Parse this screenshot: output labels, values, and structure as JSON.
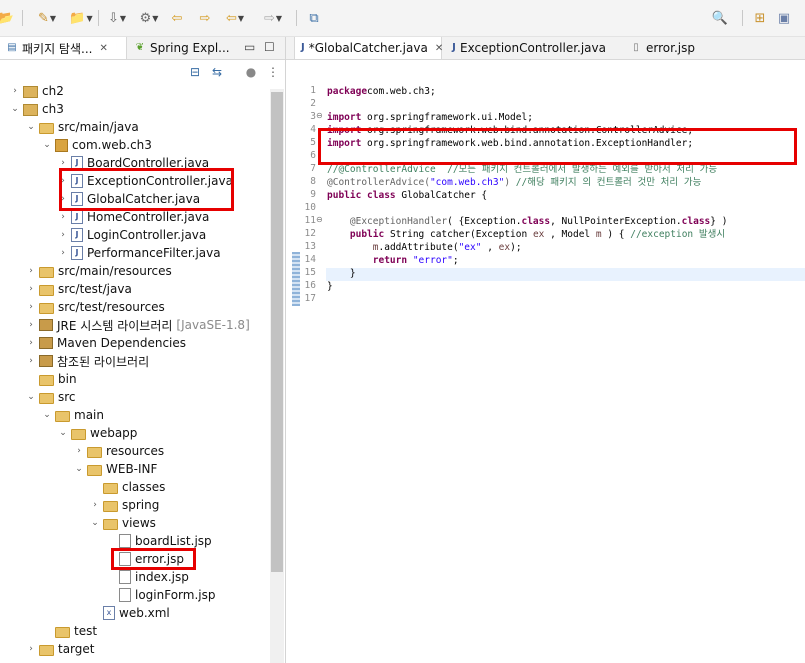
{
  "toolbar": {
    "icons": [
      "new-folder-icon",
      "run-icon",
      "open-icon",
      "download-icon",
      "tools-icon",
      "back-icon",
      "forward-icon",
      "nav-back-icon",
      "nav-forward-icon",
      "new-window-icon",
      "search-icon",
      "perspective-icon",
      "java-perspective-icon"
    ]
  },
  "left_panel": {
    "tabs": [
      {
        "label": "패키지 탐색...",
        "active": true
      },
      {
        "label": "Spring Expl...",
        "active": false
      }
    ],
    "tree": [
      {
        "label": "ch2",
        "icon": "project",
        "indent": 0,
        "twisty": ">"
      },
      {
        "label": "ch3",
        "icon": "project",
        "indent": 0,
        "twisty": "v"
      },
      {
        "label": "src/main/java",
        "icon": "srcfolder",
        "indent": 1,
        "twisty": "v"
      },
      {
        "label": "com.web.ch3",
        "icon": "package",
        "indent": 2,
        "twisty": "v"
      },
      {
        "label": "BoardController.java",
        "icon": "java",
        "indent": 3,
        "twisty": ">"
      },
      {
        "label": "ExceptionController.java",
        "icon": "java",
        "indent": 3,
        "twisty": ">"
      },
      {
        "label": "GlobalCatcher.java",
        "icon": "java",
        "indent": 3,
        "twisty": ">"
      },
      {
        "label": "HomeController.java",
        "icon": "java",
        "indent": 3,
        "twisty": ">"
      },
      {
        "label": "LoginController.java",
        "icon": "java",
        "indent": 3,
        "twisty": ">"
      },
      {
        "label": "PerformanceFilter.java",
        "icon": "java",
        "indent": 3,
        "twisty": ">"
      },
      {
        "label": "src/main/resources",
        "icon": "srcfolder",
        "indent": 1,
        "twisty": ">"
      },
      {
        "label": "src/test/java",
        "icon": "srcfolder",
        "indent": 1,
        "twisty": ">"
      },
      {
        "label": "src/test/resources",
        "icon": "srcfolder",
        "indent": 1,
        "twisty": ">"
      },
      {
        "label": "JRE 시스템 라이브러리",
        "icon": "library",
        "indent": 1,
        "twisty": ">",
        "suffix": "[JavaSE-1.8]"
      },
      {
        "label": "Maven Dependencies",
        "icon": "library",
        "indent": 1,
        "twisty": ">"
      },
      {
        "label": "참조된 라이브러리",
        "icon": "library",
        "indent": 1,
        "twisty": ">"
      },
      {
        "label": "bin",
        "icon": "folder",
        "indent": 1,
        "twisty": ""
      },
      {
        "label": "src",
        "icon": "folder",
        "indent": 1,
        "twisty": "v"
      },
      {
        "label": "main",
        "icon": "folder",
        "indent": 2,
        "twisty": "v"
      },
      {
        "label": "webapp",
        "icon": "folder",
        "indent": 3,
        "twisty": "v"
      },
      {
        "label": "resources",
        "icon": "folder",
        "indent": 4,
        "twisty": ">"
      },
      {
        "label": "WEB-INF",
        "icon": "folder",
        "indent": 4,
        "twisty": "v"
      },
      {
        "label": "classes",
        "icon": "folder",
        "indent": 5,
        "twisty": ""
      },
      {
        "label": "spring",
        "icon": "folder",
        "indent": 5,
        "twisty": ">"
      },
      {
        "label": "views",
        "icon": "folder",
        "indent": 5,
        "twisty": "v"
      },
      {
        "label": "boardList.jsp",
        "icon": "jsp",
        "indent": 6,
        "twisty": ""
      },
      {
        "label": "error.jsp",
        "icon": "jsp",
        "indent": 6,
        "twisty": ""
      },
      {
        "label": "index.jsp",
        "icon": "jsp",
        "indent": 6,
        "twisty": ""
      },
      {
        "label": "loginForm.jsp",
        "icon": "jsp",
        "indent": 6,
        "twisty": ""
      },
      {
        "label": "web.xml",
        "icon": "xml",
        "indent": 5,
        "twisty": ""
      },
      {
        "label": "test",
        "icon": "folder",
        "indent": 2,
        "twisty": ""
      },
      {
        "label": "target",
        "icon": "folder",
        "indent": 1,
        "twisty": ">"
      }
    ]
  },
  "editor": {
    "tabs": [
      {
        "label": "*GlobalCatcher.java",
        "active": true,
        "closable": true
      },
      {
        "label": "ExceptionController.java",
        "active": false,
        "closable": false
      },
      {
        "label": "error.jsp",
        "active": false,
        "closable": false
      }
    ],
    "lines": [
      {
        "n": "1",
        "fold": "",
        "tokens": [
          [
            "kw",
            "package"
          ],
          [
            "",
            "com.web.ch3;"
          ]
        ]
      },
      {
        "n": "2",
        "fold": "",
        "tokens": []
      },
      {
        "n": "3",
        "fold": "⊖",
        "tokens": [
          [
            "kw",
            "import"
          ],
          [
            "",
            " org.springframework.ui.Model;"
          ]
        ]
      },
      {
        "n": "4",
        "fold": "",
        "tokens": [
          [
            "kw",
            "import"
          ],
          [
            "",
            " org.springframework.web.bind.annotation.ControllerAdvice;"
          ]
        ]
      },
      {
        "n": "5",
        "fold": "",
        "tokens": [
          [
            "kw",
            "import"
          ],
          [
            "",
            " org.springframework.web.bind.annotation.ExceptionHandler;"
          ]
        ]
      },
      {
        "n": "6",
        "fold": "",
        "tokens": []
      },
      {
        "n": "7",
        "fold": "",
        "tokens": [
          [
            "cm",
            "//@ControllerAdvice  //모든 패키지 컨트롤러에서 발생하는 예외를 받아서 처리 가능"
          ]
        ]
      },
      {
        "n": "8",
        "fold": "",
        "tokens": [
          [
            "ann",
            "@ControllerAdvice("
          ],
          [
            "str",
            "\"com.web.ch3\""
          ],
          [
            "ann",
            ")"
          ],
          [
            "cm",
            " //해당 패키지 의 컨트롤러 것만 처리 가능"
          ]
        ]
      },
      {
        "n": "9",
        "fold": "",
        "tokens": [
          [
            "kw",
            "public class"
          ],
          [
            "",
            " GlobalCatcher {"
          ]
        ]
      },
      {
        "n": "10",
        "fold": "",
        "tokens": []
      },
      {
        "n": "11",
        "fold": "⊖",
        "tokens": [
          [
            "",
            "    "
          ],
          [
            "ann",
            "@ExceptionHandler"
          ],
          [
            "",
            "( {Exception."
          ],
          [
            "kw",
            "class"
          ],
          [
            "",
            ", NullPointerException."
          ],
          [
            "kw",
            "class"
          ],
          [
            "",
            "} )"
          ]
        ]
      },
      {
        "n": "12",
        "fold": "",
        "tokens": [
          [
            "",
            "    "
          ],
          [
            "kw",
            "public"
          ],
          [
            "",
            " String catcher(Exception "
          ],
          [
            "var",
            "ex"
          ],
          [
            "",
            " , Model "
          ],
          [
            "var",
            "m"
          ],
          [
            "",
            " ) { "
          ],
          [
            "cm",
            "//exception 발생시"
          ]
        ]
      },
      {
        "n": "13",
        "fold": "",
        "tokens": [
          [
            "",
            "        "
          ],
          [
            "var",
            "m"
          ],
          [
            "",
            ".addAttribute("
          ],
          [
            "str",
            "\"ex\""
          ],
          [
            "",
            " , "
          ],
          [
            "var",
            "ex"
          ],
          [
            "",
            ");"
          ]
        ]
      },
      {
        "n": "14",
        "fold": "",
        "tokens": [
          [
            "",
            "        "
          ],
          [
            "kw",
            "return"
          ],
          [
            "",
            ""
          ],
          [
            "str",
            " \"error\""
          ],
          [
            "",
            ";"
          ]
        ]
      },
      {
        "n": "15",
        "fold": "",
        "tokens": [
          [
            "",
            "    }"
          ]
        ]
      },
      {
        "n": "16",
        "fold": "",
        "tokens": [
          [
            "",
            "}"
          ]
        ]
      },
      {
        "n": "17",
        "fold": "",
        "tokens": []
      }
    ]
  },
  "colors": {
    "highlight_box": "#e60000",
    "keyword": "#7f0055",
    "comment": "#3f7f5f",
    "string": "#2a00ff",
    "current_line": "#e8f2fe"
  }
}
